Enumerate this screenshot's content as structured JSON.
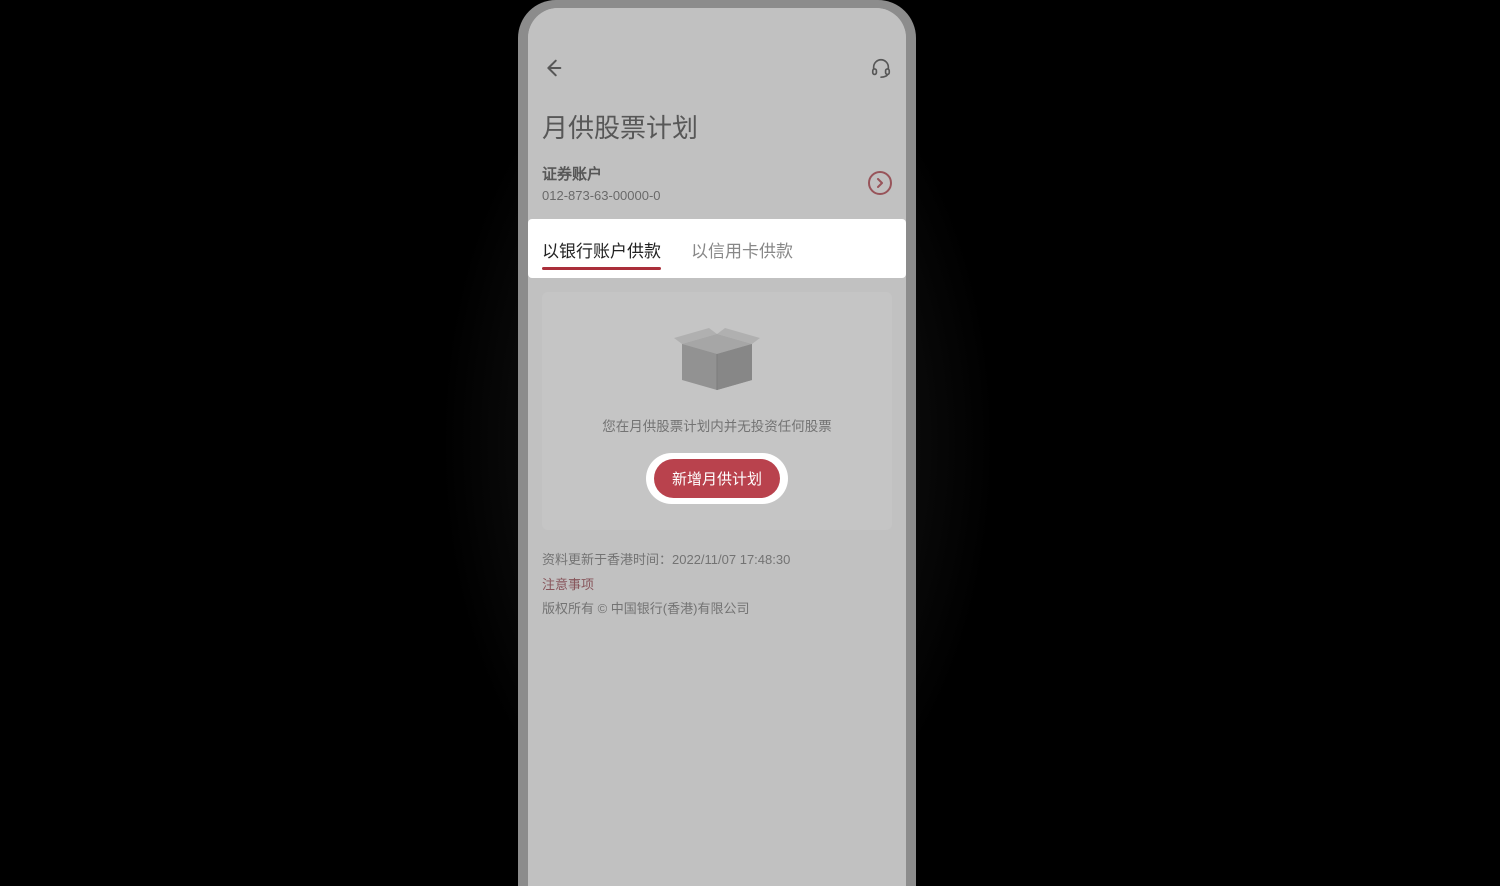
{
  "colors": {
    "accent": "#aa2f3a",
    "button": "#b9424d"
  },
  "header": {
    "page_title": "月供股票计划"
  },
  "account": {
    "label": "证券账户",
    "number": "012-873-63-00000-0"
  },
  "tabs": {
    "bank": "以银行账户供款",
    "credit": "以信用卡供款"
  },
  "empty_state": {
    "message": "您在月供股票计划内并无投资任何股票",
    "cta_label": "新增月供计划"
  },
  "footer": {
    "updated": "资料更新于香港时间：2022/11/07 17:48:30",
    "notice": "注意事项",
    "copyright": "版权所有 © 中国银行(香港)有限公司"
  }
}
